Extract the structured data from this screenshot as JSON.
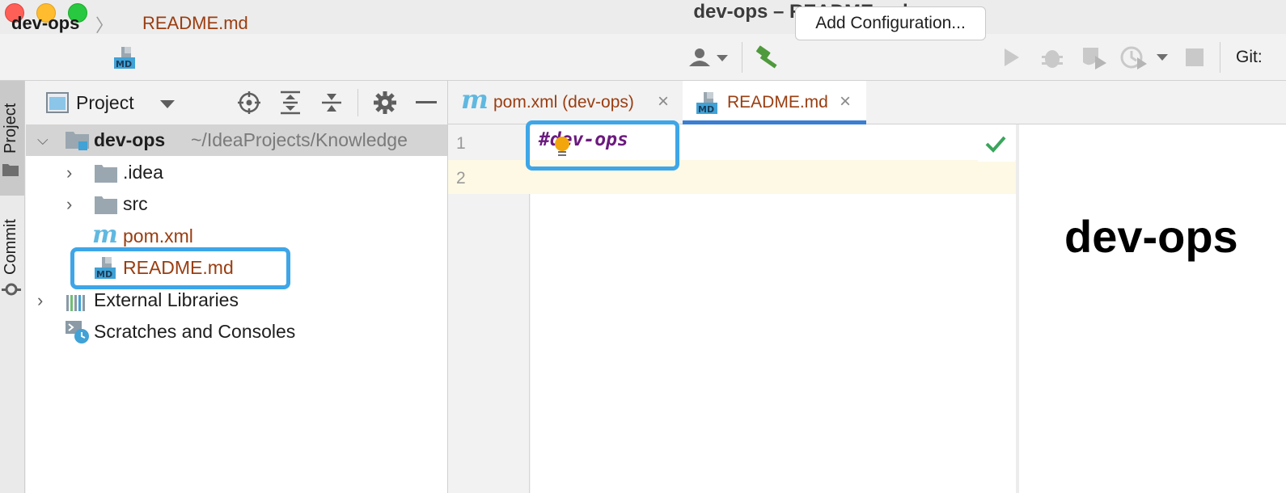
{
  "window": {
    "title": "dev-ops – README.md"
  },
  "breadcrumb": {
    "project": "dev-ops",
    "file": "README.md"
  },
  "toolbar": {
    "add_configuration_label": "Add Configuration...",
    "git_label": "Git:"
  },
  "tool_strip": {
    "project_label": "Project",
    "commit_label": "Commit"
  },
  "project_panel": {
    "title": "Project",
    "root": {
      "name": "dev-ops",
      "path": "~/IdeaProjects/Knowledge"
    },
    "items": [
      {
        "name": ".idea",
        "type": "folder",
        "expandable": true
      },
      {
        "name": "src",
        "type": "folder",
        "expandable": true
      },
      {
        "name": "pom.xml",
        "type": "maven"
      },
      {
        "name": "README.md",
        "type": "markdown"
      }
    ],
    "external_libraries": "External Libraries",
    "scratches": "Scratches and Consoles"
  },
  "tabs": [
    {
      "label": "pom.xml (dev-ops)",
      "active": false
    },
    {
      "label": "README.md",
      "active": true
    }
  ],
  "editor": {
    "line_numbers": [
      "1",
      "2"
    ],
    "line1": "#dev-ops"
  },
  "preview": {
    "heading": "dev-ops"
  },
  "colors": {
    "accent": "#3b7ed2",
    "callout": "#3ea6e8",
    "modified_file": "#9a3d10",
    "markdown_heading": "#6b1a7e",
    "check_green": "#3ba55c"
  }
}
